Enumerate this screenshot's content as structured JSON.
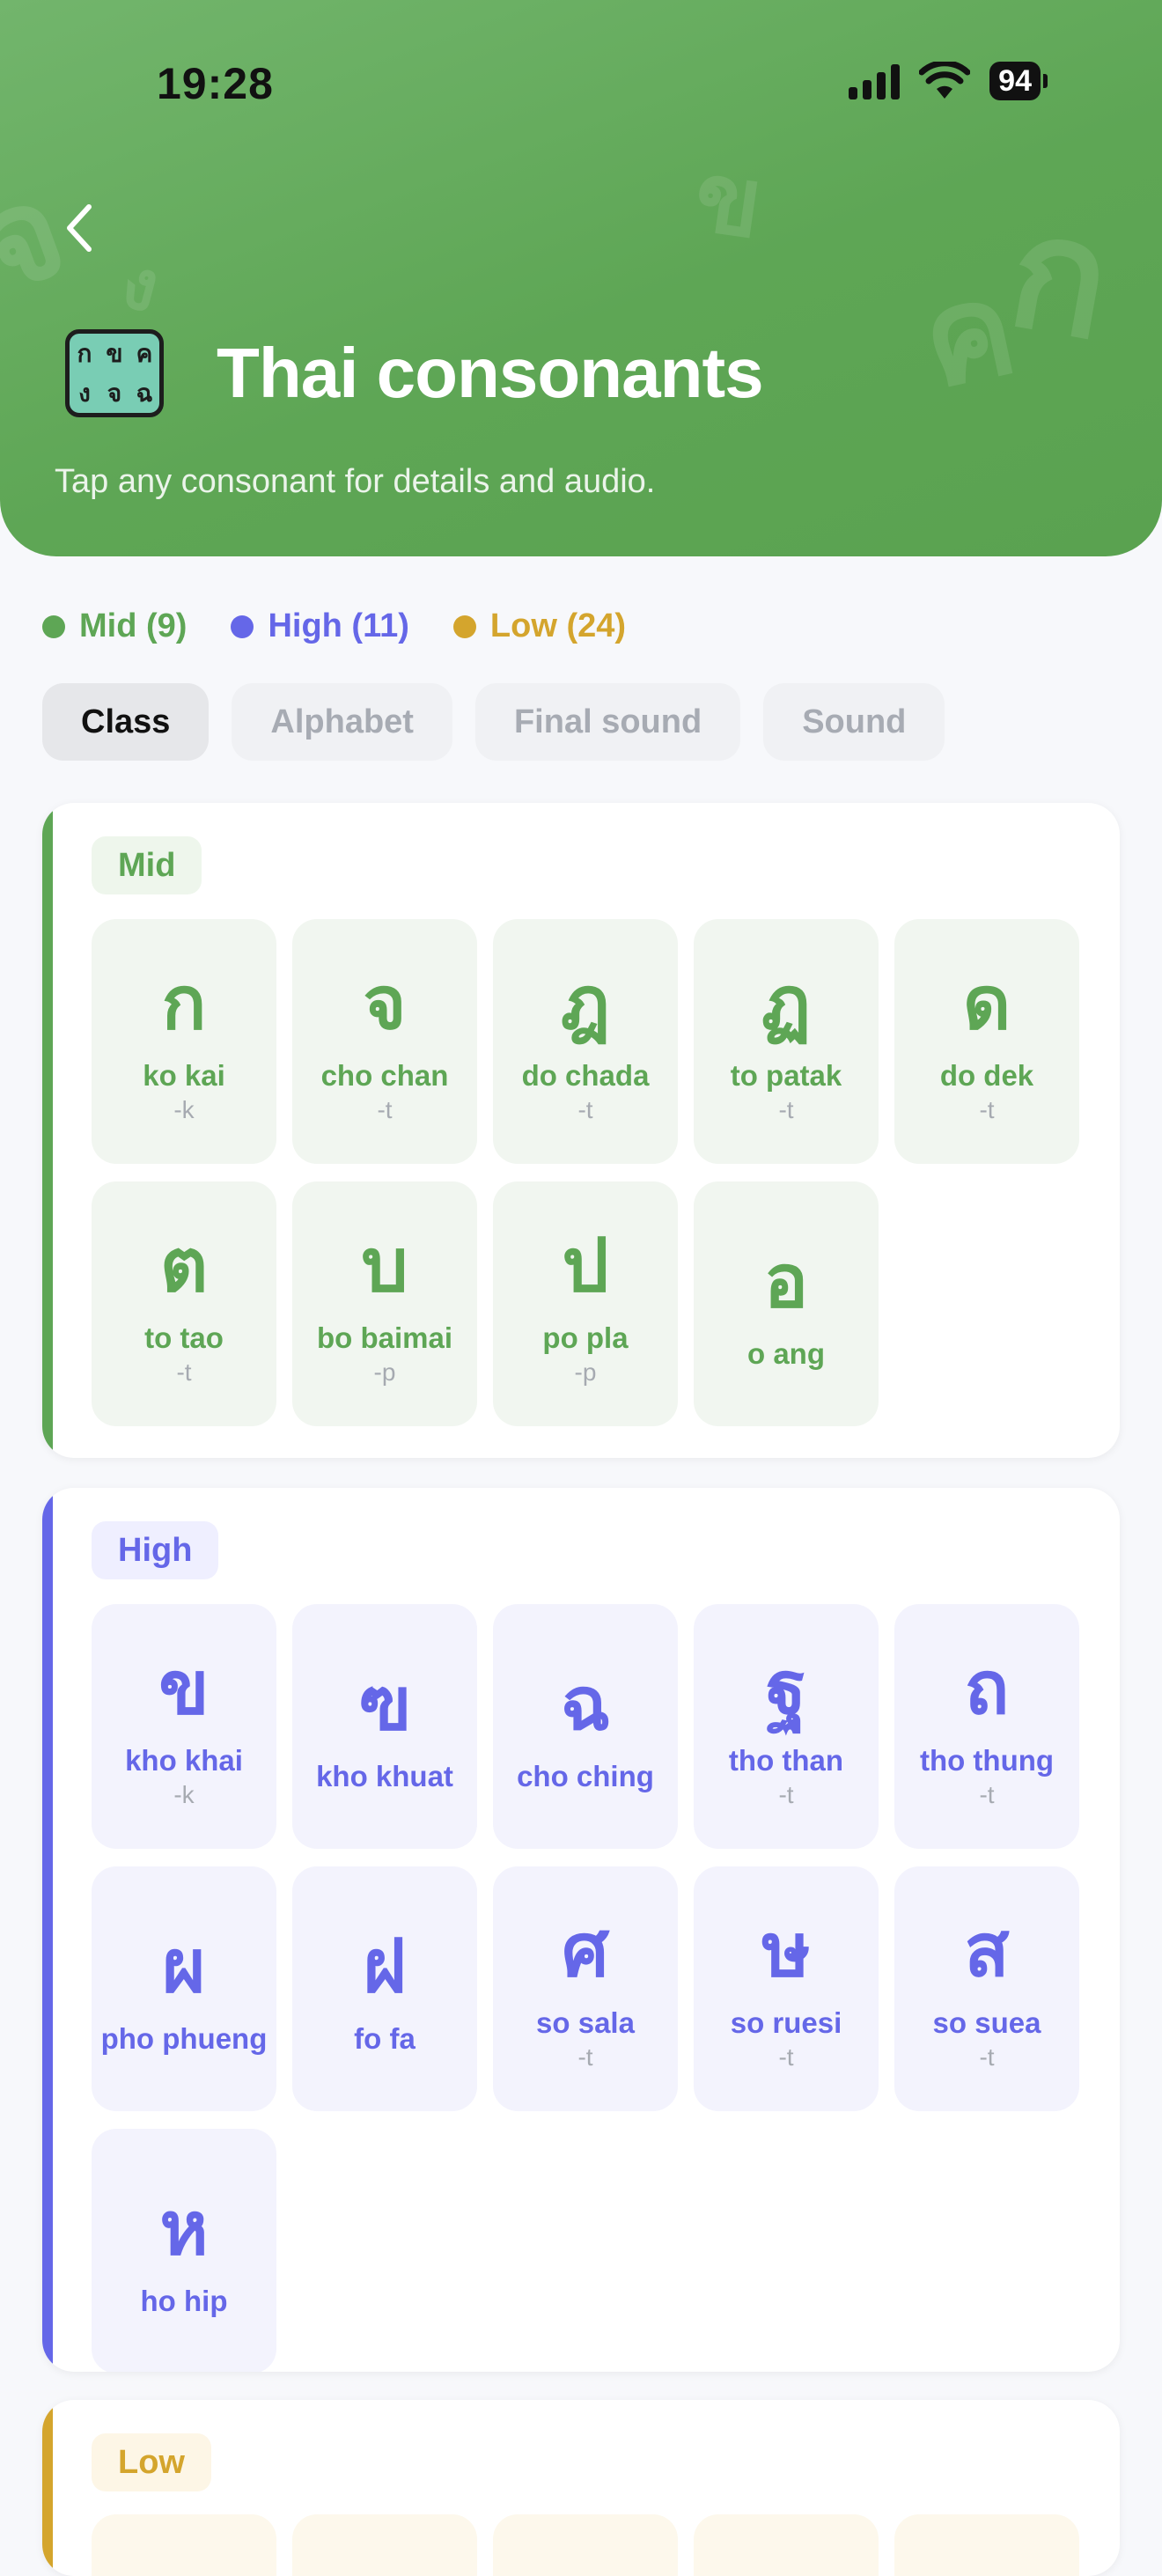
{
  "status": {
    "time": "19:28",
    "battery": "94"
  },
  "header": {
    "title": "Thai consonants",
    "subtitle": "Tap any consonant for details and audio.",
    "icon_letters": [
      "ก",
      "ข",
      "ค",
      "ง",
      "จ",
      "ฉ"
    ]
  },
  "colors": {
    "mid": "#5ea655",
    "high": "#6567e8",
    "low": "#d4a52d",
    "header_bg": "#64ab5c"
  },
  "legend": [
    {
      "label": "Mid (9)",
      "color": "#5ea655"
    },
    {
      "label": "High (11)",
      "color": "#6567e8"
    },
    {
      "label": "Low (24)",
      "color": "#d4a52d"
    }
  ],
  "tabs": [
    "Class",
    "Alphabet",
    "Final sound",
    "Sound"
  ],
  "active_tab": "Class",
  "sections": [
    {
      "label": "Mid",
      "items": [
        {
          "char": "ก",
          "name": "ko kai",
          "final": "-k"
        },
        {
          "char": "จ",
          "name": "cho chan",
          "final": "-t"
        },
        {
          "char": "ฎ",
          "name": "do chada",
          "final": "-t"
        },
        {
          "char": "ฏ",
          "name": "to patak",
          "final": "-t"
        },
        {
          "char": "ด",
          "name": "do dek",
          "final": "-t"
        },
        {
          "char": "ต",
          "name": "to tao",
          "final": "-t"
        },
        {
          "char": "บ",
          "name": "bo baimai",
          "final": "-p"
        },
        {
          "char": "ป",
          "name": "po pla",
          "final": "-p"
        },
        {
          "char": "อ",
          "name": "o ang",
          "final": ""
        }
      ]
    },
    {
      "label": "High",
      "items": [
        {
          "char": "ข",
          "name": "kho khai",
          "final": "-k"
        },
        {
          "char": "ฃ",
          "name": "kho khuat",
          "final": ""
        },
        {
          "char": "ฉ",
          "name": "cho ching",
          "final": ""
        },
        {
          "char": "ฐ",
          "name": "tho than",
          "final": "-t"
        },
        {
          "char": "ถ",
          "name": "tho thung",
          "final": "-t"
        },
        {
          "char": "ผ",
          "name": "pho phueng",
          "final": ""
        },
        {
          "char": "ฝ",
          "name": "fo fa",
          "final": ""
        },
        {
          "char": "ศ",
          "name": "so sala",
          "final": "-t"
        },
        {
          "char": "ษ",
          "name": "so ruesi",
          "final": "-t"
        },
        {
          "char": "ส",
          "name": "so suea",
          "final": "-t"
        },
        {
          "char": "ห",
          "name": "ho hip",
          "final": ""
        }
      ]
    },
    {
      "label": "Low",
      "items": []
    }
  ]
}
